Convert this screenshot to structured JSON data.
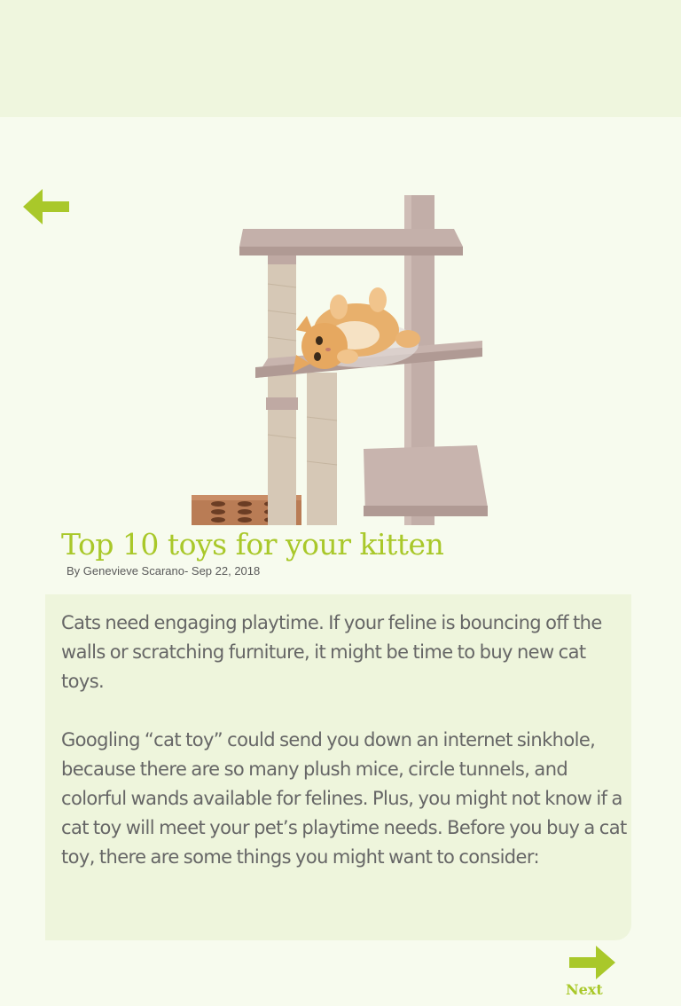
{
  "article": {
    "title": "Top 10 toys for your kitten",
    "byline": "By Genevieve Scarano- Sep 22, 2018",
    "paragraphs": [
      "Cats need engaging playtime. If your feline is bouncing off the walls or scratching furniture, it might be time to buy new cat toys.",
      "Googling “cat toy” could send you down an internet sinkhole, because there are so many plush mice, circle tunnels, and colorful wands available for felines. Plus, you might not know if a cat toy will meet your pet’s playtime needs. Before you buy a cat toy, there are some things you might want to consider:"
    ]
  },
  "nav": {
    "back_icon": "arrow-left-icon",
    "next_icon": "arrow-right-icon",
    "next_label": "Next"
  },
  "colors": {
    "accent": "#a9c82a",
    "header_bg": "#eff6de",
    "page_bg": "#f7fbee",
    "card_bg": "#eef5dc",
    "body_text": "#666666"
  }
}
